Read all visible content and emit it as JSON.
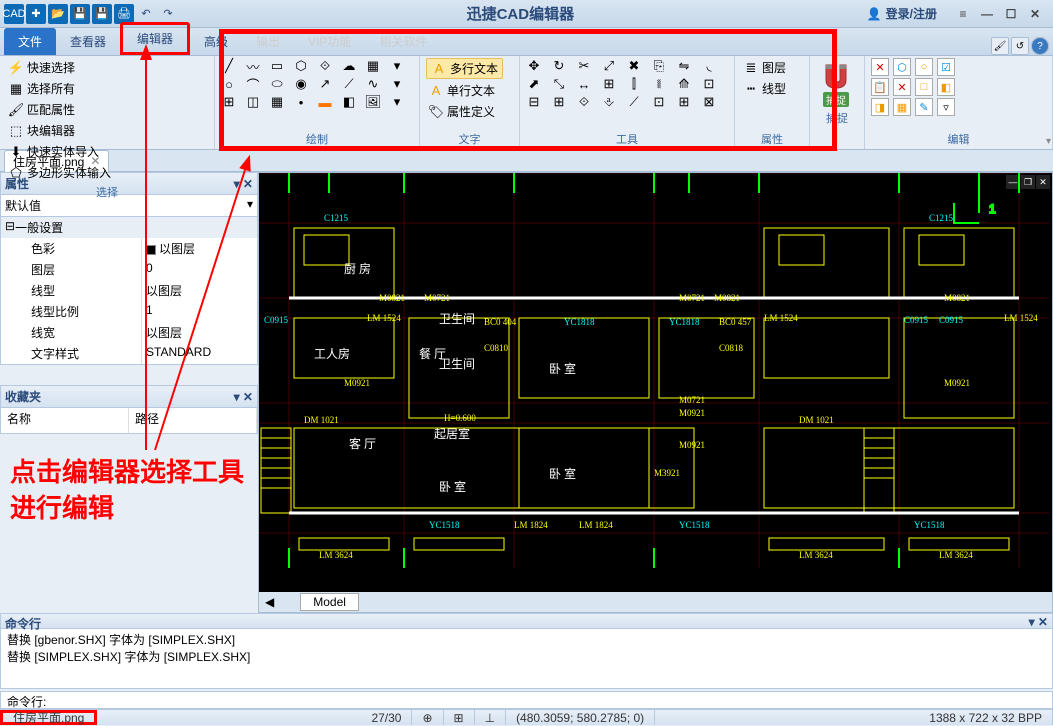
{
  "app": {
    "title": "迅捷CAD编辑器",
    "login": "登录/注册"
  },
  "menutabs": {
    "file": "文件",
    "viewer": "查看器",
    "editor": "编辑器",
    "advanced": "高级",
    "output": "输出",
    "vip": "VIP功能",
    "convert": "相关软件"
  },
  "ribbon": {
    "select_group": "选择",
    "quick_select": "快速选择",
    "select_all": "选择所有",
    "match_prop": "匹配属性",
    "block_editor": "块编辑器",
    "quick_entity_import": "快速实体导入",
    "polygon_entity_input": "多边形实体输入",
    "draw_group": "绘制",
    "text_group": "文字",
    "mtext": "多行文本",
    "stext": "单行文本",
    "attr_def": "属性定义",
    "tool_group": "工具",
    "prop_group": "属性",
    "layer": "图层",
    "linetype": "线型",
    "capture_group": "捕捉",
    "capture": "捕捉",
    "edit_group": "编辑"
  },
  "doctab": "住房平面.png",
  "props": {
    "hdr": "属性",
    "default": "默认值",
    "general": "一般设置",
    "color_k": "色彩",
    "color_v": "以图层",
    "layer_k": "图层",
    "layer_v": "0",
    "linetype_k": "线型",
    "linetype_v": "以图层",
    "ltscale_k": "线型比例",
    "ltscale_v": "1",
    "lineweight_k": "线宽",
    "lineweight_v": "以图层",
    "textstyle_k": "文字样式",
    "textstyle_v": "STANDARD"
  },
  "fav": {
    "hdr": "收藏夹",
    "name": "名称",
    "path": "路径"
  },
  "annotation": "点击编辑器选择工具进行编辑",
  "model_tab": "Model",
  "cmd": {
    "hdr": "命令行",
    "line1": "替换 [gbenor.SHX] 字体为 [SIMPLEX.SHX]",
    "line2": "替换 [SIMPLEX.SHX] 字体为 [SIMPLEX.SHX]",
    "prompt": "命令行:"
  },
  "status": {
    "file": "住房平面.png",
    "page": "27/30",
    "coords": "(480.3059; 580.2785; 0)",
    "dims": "1388 x 722 x 32 BPP"
  },
  "cad": {
    "kitchen": "厨 房",
    "worker": "工人房",
    "dining": "餐 厅",
    "living": "客 厅",
    "bedroom": "卧 室",
    "rising": "起居室",
    "bath": "卫生间",
    "c1215": "C1215",
    "c0915": "C0915",
    "m0821": "M0821",
    "m0721": "M0721",
    "lm1524": "LM 1524",
    "yc1818": "YC1818",
    "yc1518": "YC1518",
    "lm1824": "LM 1824",
    "lm3624": "LM 3624",
    "dm1021": "DM 1021",
    "m0921": "M0921",
    "bc0404": "BC0 404",
    "bc0457": "BC0 457",
    "c0810": "C0810",
    "c0818": "C0818",
    "m3921": "M3921",
    "h600": "H=0.600"
  }
}
